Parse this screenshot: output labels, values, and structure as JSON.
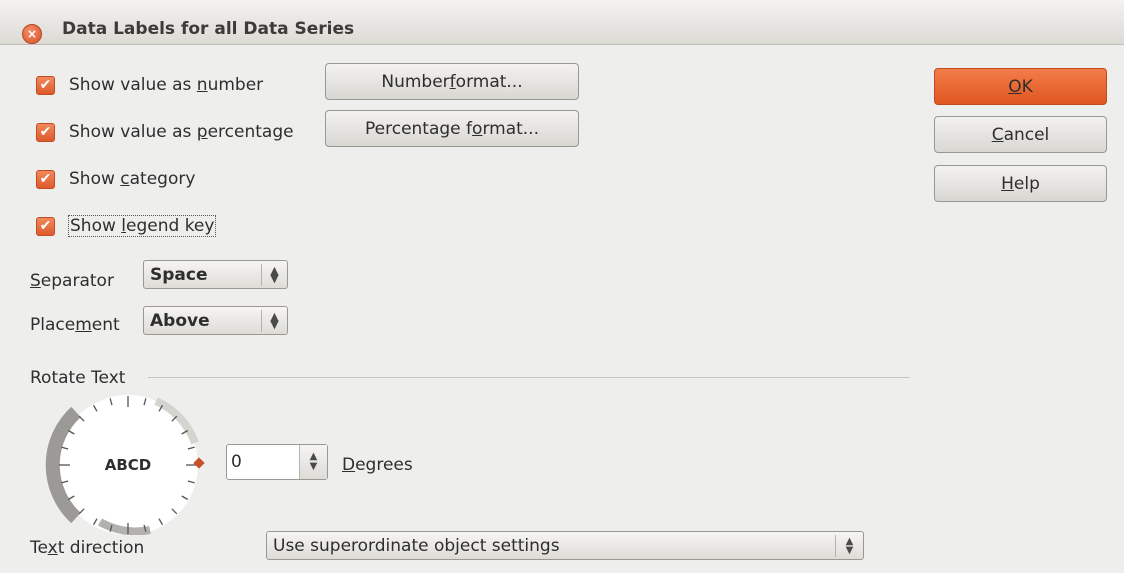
{
  "window": {
    "title": "Data Labels for all Data Series",
    "close_glyph": "×"
  },
  "checkboxes": [
    {
      "label_pre": "Show value as ",
      "mnemonic": "n",
      "label_post": "umber",
      "checked": true
    },
    {
      "label_pre": "Show value as ",
      "mnemonic": "p",
      "label_post": "ercentage",
      "checked": true
    },
    {
      "label_pre": "Show ",
      "mnemonic": "c",
      "label_post": "ategory",
      "checked": true
    },
    {
      "label_pre": "Show ",
      "mnemonic": "l",
      "label_post": "egend key",
      "checked": true
    }
  ],
  "buttons": {
    "number_format": {
      "pre": "Number ",
      "mnemonic": "f",
      "post": "ormat..."
    },
    "percentage_format": {
      "pre": "Percentage f",
      "mnemonic": "o",
      "post": "rmat..."
    },
    "ok": {
      "pre": "",
      "mnemonic": "O",
      "post": "K"
    },
    "cancel": {
      "pre": "",
      "mnemonic": "C",
      "post": "ancel"
    },
    "help": {
      "pre": "",
      "mnemonic": "H",
      "post": "elp"
    }
  },
  "separator": {
    "label_mnemonic": "S",
    "label_post": "eparator",
    "value": "Space"
  },
  "placement": {
    "label_pre": "Place",
    "label_mnemonic": "m",
    "label_post": "ent",
    "value": "Above"
  },
  "rotate": {
    "section_title": "Rotate Text",
    "dial_text": "ABCD",
    "degrees_value": "0",
    "degrees_label_mnemonic": "D",
    "degrees_label_post": "egrees"
  },
  "text_direction": {
    "label_pre": "Te",
    "label_mnemonic": "x",
    "label_post": "t direction",
    "value": "Use superordinate object settings"
  },
  "icons": {
    "check": "✔",
    "spin_up": "▲",
    "spin_down": "▼"
  },
  "colors": {
    "accent": "#e0561f",
    "dial_marker": "#c8502a"
  }
}
